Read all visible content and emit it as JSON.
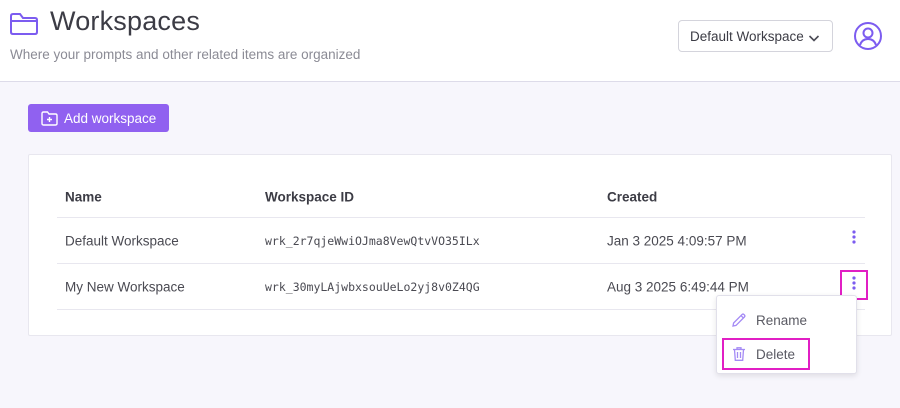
{
  "header": {
    "title": "Workspaces",
    "subtitle": "Where your prompts and other related items are organized",
    "workspace_selector": "Default Workspace"
  },
  "toolbar": {
    "add_label": "Add workspace"
  },
  "table": {
    "columns": [
      "Name",
      "Workspace ID",
      "Created"
    ],
    "rows": [
      {
        "name": "Default Workspace",
        "id": "wrk_2r7qjeWwiOJma8VewQtvVO35ILx",
        "created": "Jan 3 2025 4:09:57 PM"
      },
      {
        "name": "My New Workspace",
        "id": "wrk_30myLAjwbxsouUeLo2yj8v0Z4QG",
        "created": "Aug 3 2025 6:49:44 PM"
      }
    ]
  },
  "row_menu": {
    "items": [
      {
        "label": "Rename",
        "icon": "pencil-icon"
      },
      {
        "label": "Delete",
        "icon": "trash-icon"
      }
    ]
  },
  "colors": {
    "accent": "#7c5cf0",
    "button": "#9061f0",
    "highlight": "#e11fc4"
  }
}
